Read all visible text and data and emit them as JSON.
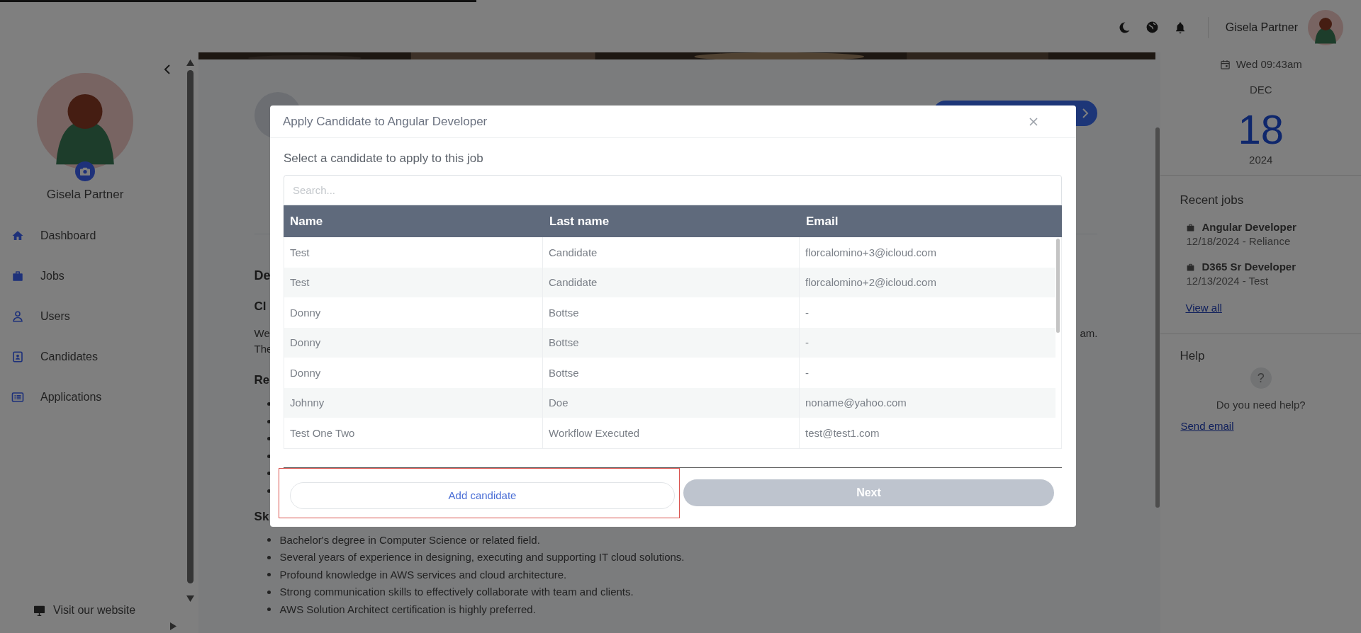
{
  "loading_bar": {
    "level": 0.35
  },
  "top_bar": {
    "user_name": "Gisela Partner"
  },
  "sidebar": {
    "user_name": "Gisela Partner",
    "items": [
      {
        "label": "Dashboard"
      },
      {
        "label": "Jobs"
      },
      {
        "label": "Users"
      },
      {
        "label": "Candidates"
      },
      {
        "label": "Applications"
      }
    ],
    "footer_link": "Visit our website"
  },
  "job_page": {
    "fragments": [
      {
        "kind": "heading",
        "text": "De"
      },
      {
        "kind": "subheading",
        "text": "Cl"
      },
      {
        "kind": "line",
        "text": "We",
        "tail": "am."
      },
      {
        "kind": "line",
        "text": "The"
      },
      {
        "kind": "subheading",
        "text": "Re"
      },
      {
        "kind": "bullet"
      },
      {
        "kind": "bullet"
      },
      {
        "kind": "bullet"
      },
      {
        "kind": "bullet"
      },
      {
        "kind": "bullet"
      },
      {
        "kind": "bullet"
      },
      {
        "kind": "subheading",
        "text": "Sk"
      },
      {
        "kind": "bullet",
        "text": "Bachelor's degree in Computer Science or related field."
      },
      {
        "kind": "bullet",
        "text": "Several years of experience in designing, executing and supporting IT cloud solutions."
      },
      {
        "kind": "bullet",
        "text": "Profound knowledge in AWS services and cloud architecture."
      },
      {
        "kind": "bullet",
        "text": "Strong communication skills to effectively collaborate with team and clients."
      },
      {
        "kind": "bullet",
        "text": "AWS Solution Architect certification is highly preferred."
      }
    ]
  },
  "modal": {
    "title": "Apply Candidate to Angular Developer",
    "subtitle": "Select a candidate to apply to this job",
    "search": {
      "placeholder": "Search..."
    },
    "table": {
      "columns": [
        "Name",
        "Last name",
        "Email"
      ],
      "rows": [
        [
          "Test",
          "Candidate",
          "florcalomino+3@icloud.com"
        ],
        [
          "Test",
          "Candidate",
          "florcalomino+2@icloud.com"
        ],
        [
          "Donny",
          "Bottse",
          "-"
        ],
        [
          "Donny",
          "Bottse",
          "-"
        ],
        [
          "Donny",
          "Bottse",
          "-"
        ],
        [
          "Johnny",
          "Doe",
          "noname@yahoo.com"
        ],
        [
          "Test One Two",
          "Workflow Executed",
          "test@test1.com"
        ]
      ]
    },
    "buttons": [
      {
        "label": "Add candidate",
        "kind": "secondary",
        "highlighted": true,
        "disabled": false
      },
      {
        "label": "Next",
        "kind": "primary",
        "highlighted": false,
        "disabled": true
      }
    ]
  },
  "right_panel": {
    "date": {
      "weekday_time": "Wed 09:43am",
      "month": "DEC",
      "day": "18",
      "year": "2024"
    },
    "recent_jobs": {
      "title": "Recent jobs",
      "items": [
        {
          "title": "Angular Developer",
          "meta": "12/18/2024 - Reliance"
        },
        {
          "title": "D365 Sr Developer",
          "meta": "12/13/2024 - Test"
        }
      ],
      "link": "View all"
    },
    "help": {
      "title": "Help",
      "symbol": "?",
      "text": "Do you need help?",
      "link": "Send email"
    }
  }
}
